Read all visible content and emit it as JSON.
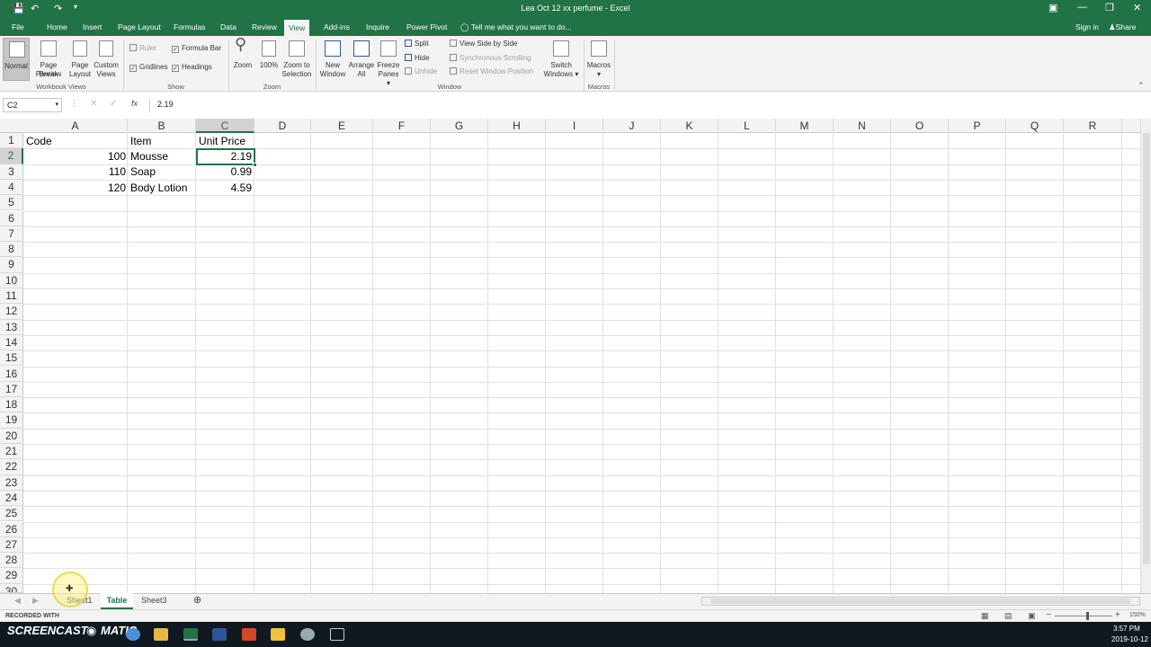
{
  "window": {
    "title": "Lea Oct 12 xx perfume - Excel"
  },
  "titlebar": {
    "sign_in": "Sign in",
    "share": "Share"
  },
  "tabs": [
    "File",
    "Home",
    "Insert",
    "Page Layout",
    "Formulas",
    "Data",
    "Review",
    "View",
    "Add-ins",
    "Inquire",
    "Power Pivot"
  ],
  "active_tab": "View",
  "tell_me": "Tell me what you want to do...",
  "ribbon": {
    "workbook_views": {
      "label": "Workbook Views",
      "normal": "Normal",
      "page_break": "Page Break",
      "page_break2": "Preview",
      "page_layout": "Page",
      "page_layout2": "Layout",
      "custom": "Custom",
      "custom2": "Views"
    },
    "show": {
      "label": "Show",
      "ruler": "Ruler",
      "formula_bar": "Formula Bar",
      "gridlines": "Gridlines",
      "headings": "Headings"
    },
    "zoom": {
      "label": "Zoom",
      "zoom": "Zoom",
      "hundred": "100%",
      "zoom_sel": "Zoom to",
      "zoom_sel2": "Selection"
    },
    "window": {
      "label": "Window",
      "new_window": "New",
      "new_window2": "Window",
      "arrange": "Arrange",
      "arrange2": "All",
      "freeze": "Freeze",
      "freeze2": "Panes",
      "split": "Split",
      "hide": "Hide",
      "unhide": "Unhide",
      "view_side": "View Side by Side",
      "sync": "Synchronous Scrolling",
      "reset": "Reset Window Position",
      "switch": "Switch",
      "switch2": "Windows"
    },
    "macros": {
      "label": "Macros",
      "macros": "Macros"
    }
  },
  "formula_bar": {
    "name_box": "C2",
    "fx": "fx",
    "value": "2.19"
  },
  "columns": [
    "A",
    "B",
    "C",
    "D",
    "E",
    "F",
    "G",
    "H",
    "I",
    "J",
    "K",
    "L",
    "M",
    "N",
    "O",
    "P",
    "Q",
    "R"
  ],
  "selected_column": "C",
  "rows": [
    "1",
    "2",
    "3",
    "4",
    "5",
    "6",
    "7",
    "8",
    "9",
    "10",
    "11",
    "12",
    "13",
    "14",
    "15",
    "16",
    "17",
    "18",
    "19",
    "20",
    "21",
    "22",
    "23",
    "24",
    "25",
    "26",
    "27",
    "28",
    "29",
    "30"
  ],
  "selected_row": "2",
  "table": {
    "headers": [
      "Code",
      "Item",
      "Unit Price"
    ],
    "rows": [
      [
        "100",
        "Mousse",
        "2.19"
      ],
      [
        "110",
        "Soap",
        "0.99"
      ],
      [
        "120",
        "Body Lotion",
        "4.59"
      ]
    ]
  },
  "sheets": [
    "Sheet1",
    "Table",
    "Sheet3"
  ],
  "active_sheet": "Table",
  "statusbar": {
    "zoom": "150%"
  },
  "watermark": {
    "line1": "RECORDED WITH",
    "line2": "SCREENCAST",
    "line3": "MATIC"
  },
  "taskbar": {
    "time": "3:57 PM",
    "date": "2019-10-12"
  }
}
